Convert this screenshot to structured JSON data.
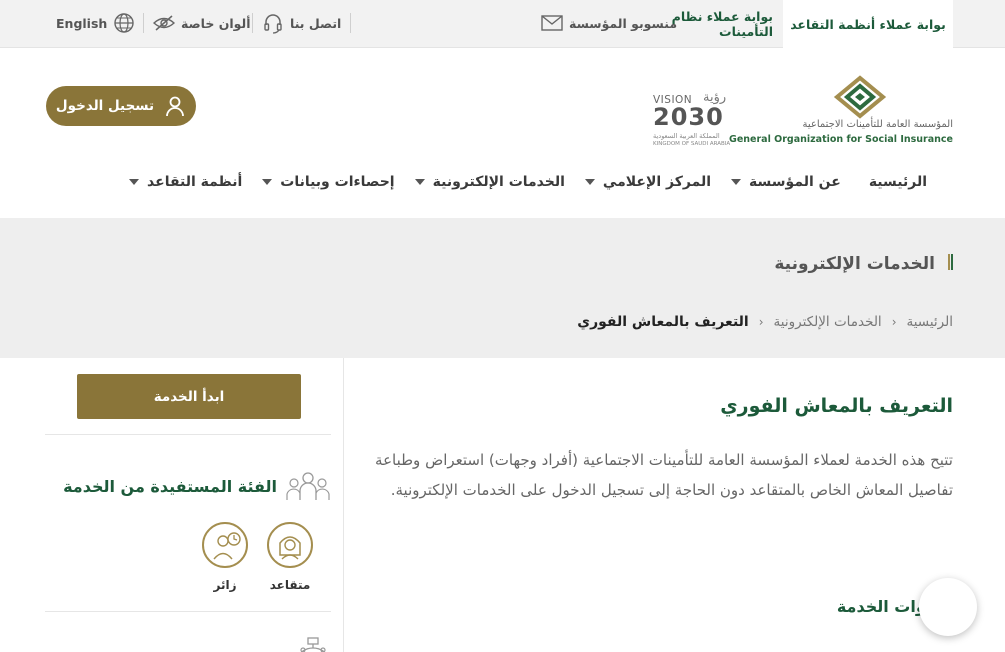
{
  "topbar": {
    "portals": [
      "بوابة عملاء أنظمة التقاعد",
      "بوابة عملاء نظام التأمينات"
    ],
    "utilities": {
      "staff": "منسوبو المؤسسة",
      "contact": "اتصل بنا",
      "colors": "ألوان خاصة",
      "language": "English"
    }
  },
  "header": {
    "logo_ar": "المؤسسة العامة للتأمينات الاجتماعية",
    "logo_en": "General Organization for Social Insurance",
    "vision_word": "رؤية",
    "vision_label": "VISION",
    "vision_number": "2030",
    "vision_kingdom_ar": "المملكة العربية السعودية",
    "vision_kingdom_en": "KINGDOM OF SAUDI ARABIA",
    "login": "تسجيل الدخول",
    "nav": [
      "الرئيسية",
      "عن المؤسسة",
      "المركز الإعلامي",
      "الخدمات الإلكترونية",
      "إحصاءات وبيانات",
      "أنظمة التقاعد"
    ]
  },
  "band": {
    "title": "الخدمات الإلكترونية",
    "breadcrumb": [
      "الرئيسية",
      "الخدمات الإلكترونية",
      "التعريف بالمعاش الفوري"
    ]
  },
  "main": {
    "heading": "التعريف بالمعاش الفوري",
    "description": "تتيح هذه الخدمة لعملاء المؤسسة العامة للتأمينات الاجتماعية (أفراد وجهات) استعراض وطباعة تفاصيل المعاش الخاص بالمتقاعد دون الحاجة إلى تسجيل الدخول على الخدمات الإلكترونية.",
    "steps_heading": "خطوات الخدمة"
  },
  "sidebar": {
    "start_button": "ابدأ الخدمة",
    "beneficiaries_heading": "الفئة المستفيدة من الخدمة",
    "beneficiaries": [
      "متقاعد",
      "زائر"
    ]
  },
  "colors": {
    "brand_green": "#1c5a3a",
    "brand_gold": "#8a7539"
  }
}
